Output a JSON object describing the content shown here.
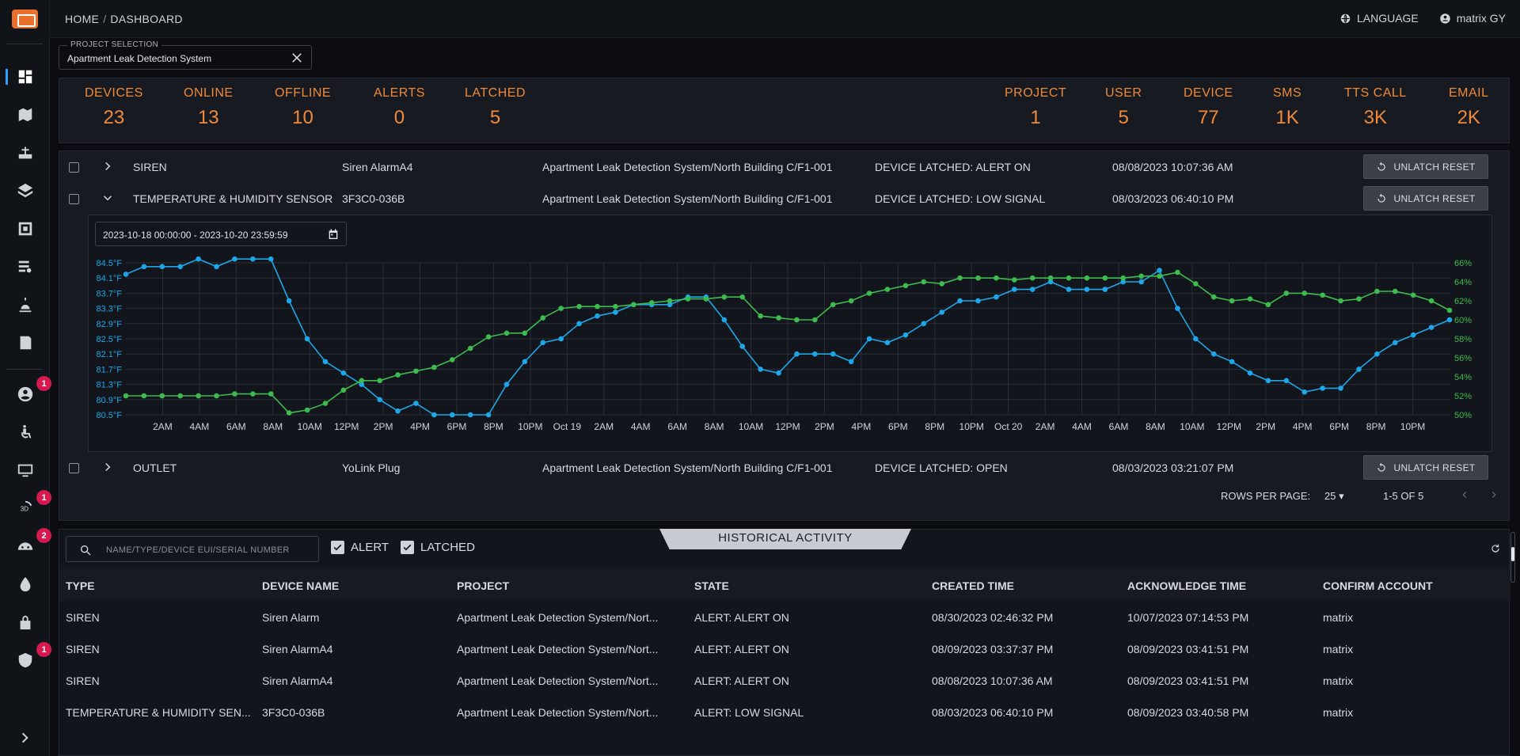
{
  "breadcrumb": {
    "home": "HOME",
    "sep": "/",
    "current": "DASHBOARD"
  },
  "topbar": {
    "language": "LANGUAGE",
    "user": "matrix GY"
  },
  "sidebar": {
    "badges": {
      "users": "1",
      "3d": "1",
      "robot": "2",
      "shield": "1"
    }
  },
  "project_selection": {
    "label": "PROJECT SELECTION",
    "value": "Apartment Leak Detection System"
  },
  "stats_left": [
    {
      "label": "DEVICES",
      "value": "23"
    },
    {
      "label": "ONLINE",
      "value": "13"
    },
    {
      "label": "OFFLINE",
      "value": "10"
    },
    {
      "label": "ALERTS",
      "value": "0"
    },
    {
      "label": "LATCHED",
      "value": "5"
    }
  ],
  "stats_right": [
    {
      "label": "PROJECT",
      "value": "1"
    },
    {
      "label": "USER",
      "value": "5"
    },
    {
      "label": "DEVICE",
      "value": "77"
    },
    {
      "label": "SMS",
      "value": "1K"
    },
    {
      "label": "TTS CALL",
      "value": "3K"
    },
    {
      "label": "EMAIL",
      "value": "2K"
    }
  ],
  "device_rows": [
    {
      "type": "SIREN",
      "name": "Siren AlarmA4",
      "path": "Apartment Leak Detection System/North Building C/F1-001",
      "state": "DEVICE LATCHED: ALERT ON",
      "time": "08/08/2023 10:07:36 AM",
      "button": "UNLATCH RESET"
    },
    {
      "type": "TEMPERATURE & HUMIDITY SENSOR",
      "name": "3F3C0-036B",
      "path": "Apartment Leak Detection System/North Building C/F1-001",
      "state": "DEVICE LATCHED: LOW SIGNAL",
      "time": "08/03/2023 06:40:10 PM",
      "button": "UNLATCH RESET"
    },
    {
      "type": "OUTLET",
      "name": "YoLink Plug",
      "path": "Apartment Leak Detection System/North Building C/F1-001",
      "state": "DEVICE LATCHED: OPEN",
      "time": "08/03/2023 03:21:07 PM",
      "button": "UNLATCH RESET"
    }
  ],
  "date_range": "2023-10-18 00:00:00 - 2023-10-20 23:59:59",
  "pager": {
    "rows_label": "ROWS PER PAGE:",
    "rows_value": "25",
    "range": "1-5 OF 5"
  },
  "chart_data": {
    "type": "line",
    "x_tick_labels": [
      "2AM",
      "4AM",
      "6AM",
      "8AM",
      "10AM",
      "12PM",
      "2PM",
      "4PM",
      "6PM",
      "8PM",
      "10PM",
      "Oct 19",
      "2AM",
      "4AM",
      "6AM",
      "8AM",
      "10AM",
      "12PM",
      "2PM",
      "4PM",
      "6PM",
      "8PM",
      "10PM",
      "Oct 20",
      "2AM",
      "4AM",
      "6AM",
      "8AM",
      "10AM",
      "12PM",
      "2PM",
      "4PM",
      "6PM",
      "8PM",
      "10PM"
    ],
    "y_left_ticks": [
      "80.5°F",
      "80.9°F",
      "81.3°F",
      "81.7°F",
      "82.1°F",
      "82.5°F",
      "82.9°F",
      "83.3°F",
      "83.7°F",
      "84.1°F",
      "84.5°F"
    ],
    "y_right_ticks": [
      "50%",
      "52%",
      "54%",
      "56%",
      "58%",
      "60%",
      "62%",
      "64%",
      "66%"
    ],
    "ylim_left": [
      80.5,
      84.5
    ],
    "ylim_right": [
      50,
      66
    ],
    "series": [
      {
        "color": "#1ea7e8",
        "axis": "left",
        "values": [
          84.2,
          84.4,
          84.4,
          84.4,
          84.6,
          84.4,
          84.6,
          84.6,
          84.6,
          83.5,
          82.5,
          81.9,
          81.6,
          81.3,
          80.9,
          80.6,
          80.8,
          80.5,
          80.5,
          80.5,
          80.5,
          81.3,
          81.9,
          82.4,
          82.5,
          82.9,
          83.1,
          83.2,
          83.4,
          83.4,
          83.4,
          83.6,
          83.6,
          83.0,
          82.3,
          81.7,
          81.6,
          82.1,
          82.1,
          82.1,
          81.9,
          82.5,
          82.4,
          82.6,
          82.9,
          83.2,
          83.5,
          83.5,
          83.6,
          83.8,
          83.8,
          84.0,
          83.8,
          83.8,
          83.8,
          84.0,
          84.0,
          84.3,
          83.3,
          82.5,
          82.1,
          81.9,
          81.6,
          81.4,
          81.4,
          81.1,
          81.2,
          81.2,
          81.7,
          82.1,
          82.4,
          82.6,
          82.8,
          83.0
        ]
      },
      {
        "color": "#3dbb4f",
        "axis": "right",
        "values": [
          52.0,
          52.0,
          52.0,
          52.0,
          52.0,
          52.0,
          52.2,
          52.2,
          52.2,
          50.2,
          50.5,
          51.2,
          52.6,
          53.6,
          53.6,
          54.2,
          54.6,
          55.0,
          55.8,
          57.0,
          58.2,
          58.6,
          58.6,
          60.2,
          61.2,
          61.4,
          61.4,
          61.4,
          61.6,
          61.8,
          62.0,
          62.2,
          62.2,
          62.4,
          62.4,
          60.4,
          60.2,
          60.0,
          60.0,
          61.6,
          62.0,
          62.8,
          63.2,
          63.6,
          64.0,
          63.8,
          64.4,
          64.4,
          64.4,
          64.2,
          64.4,
          64.4,
          64.4,
          64.4,
          64.4,
          64.4,
          64.6,
          64.6,
          65.0,
          63.8,
          62.4,
          62.0,
          62.2,
          61.6,
          62.8,
          62.8,
          62.6,
          62.0,
          62.2,
          63.0,
          63.0,
          62.6,
          62.0,
          61.0
        ]
      }
    ]
  },
  "history": {
    "title": "HISTORICAL ACTIVITY",
    "search_placeholder": "NAME/TYPE/DEVICE EUI/SERIAL NUMBER",
    "filter_alert": "ALERT",
    "filter_latched": "LATCHED",
    "columns": [
      "TYPE",
      "DEVICE NAME",
      "PROJECT",
      "STATE",
      "CREATED TIME",
      "ACKNOWLEDGE TIME",
      "CONFIRM ACCOUNT"
    ],
    "rows": [
      [
        "SIREN",
        "Siren Alarm",
        "Apartment Leak Detection System/Nort...",
        "ALERT: ALERT ON",
        "08/30/2023 02:46:32 PM",
        "10/07/2023 07:14:53 PM",
        "matrix"
      ],
      [
        "SIREN",
        "Siren AlarmA4",
        "Apartment Leak Detection System/Nort...",
        "ALERT: ALERT ON",
        "08/09/2023 03:37:37 PM",
        "08/09/2023 03:41:51 PM",
        "matrix"
      ],
      [
        "SIREN",
        "Siren AlarmA4",
        "Apartment Leak Detection System/Nort...",
        "ALERT: ALERT ON",
        "08/08/2023 10:07:36 AM",
        "08/09/2023 03:41:51 PM",
        "matrix"
      ],
      [
        "TEMPERATURE & HUMIDITY SEN...",
        "3F3C0-036B",
        "Apartment Leak Detection System/Nort...",
        "ALERT: LOW SIGNAL",
        "08/03/2023 06:40:10 PM",
        "08/09/2023 03:40:58 PM",
        "matrix"
      ]
    ]
  }
}
